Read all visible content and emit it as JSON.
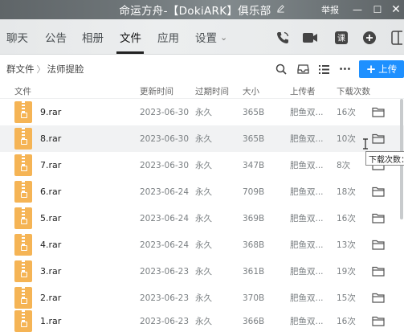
{
  "window": {
    "title": "命运方舟-【DokiARK】俱乐部",
    "edit_icon": "pencil-icon",
    "report_label": "举报",
    "controls": {
      "minimize": "—",
      "maximize": "☐",
      "close": "✕"
    }
  },
  "nav": {
    "tabs": [
      {
        "label": "聊天"
      },
      {
        "label": "公告"
      },
      {
        "label": "相册"
      },
      {
        "label": "文件"
      },
      {
        "label": "应用"
      },
      {
        "label": "设置"
      }
    ],
    "settings_chevron": "⌄",
    "active_tab": "文件"
  },
  "breadcrumb": {
    "root": "群文件",
    "separator": "〉",
    "current": "法师提脸"
  },
  "toolbar": {
    "more_label": "•••",
    "upload_label": "上传"
  },
  "table": {
    "headers": {
      "name": "文件",
      "updated": "更新时间",
      "expire": "过期时间",
      "size": "大小",
      "uploader": "上传者",
      "downloads": "下载次数"
    },
    "rows": [
      {
        "name": "9.rar",
        "updated": "2023-06-30",
        "expire": "永久",
        "size": "365B",
        "uploader": "肥鱼双...",
        "downloads": "16次"
      },
      {
        "name": "8.rar",
        "updated": "2023-06-30",
        "expire": "永久",
        "size": "365B",
        "uploader": "肥鱼双...",
        "downloads": "10次"
      },
      {
        "name": "7.rar",
        "updated": "2023-06-30",
        "expire": "永久",
        "size": "347B",
        "uploader": "肥鱼双...",
        "downloads": "8次"
      },
      {
        "name": "6.rar",
        "updated": "2023-06-24",
        "expire": "永久",
        "size": "709B",
        "uploader": "肥鱼双...",
        "downloads": "18次"
      },
      {
        "name": "5.rar",
        "updated": "2023-06-24",
        "expire": "永久",
        "size": "369B",
        "uploader": "肥鱼双...",
        "downloads": "16次"
      },
      {
        "name": "4.rar",
        "updated": "2023-06-24",
        "expire": "永久",
        "size": "368B",
        "uploader": "肥鱼双...",
        "downloads": "13次"
      },
      {
        "name": "3.rar",
        "updated": "2023-06-23",
        "expire": "永久",
        "size": "361B",
        "uploader": "肥鱼双...",
        "downloads": "19次"
      },
      {
        "name": "2.rar",
        "updated": "2023-06-23",
        "expire": "永久",
        "size": "370B",
        "uploader": "肥鱼双...",
        "downloads": "15次"
      },
      {
        "name": "1.rar",
        "updated": "2023-06-23",
        "expire": "永久",
        "size": "366B",
        "uploader": "肥鱼双...",
        "downloads": "16次"
      }
    ]
  },
  "tooltip": {
    "text": "下载次数："
  },
  "colors": {
    "accent": "#1e90ff",
    "zip_icon": "#f5b455",
    "hover_row": "#f1f2f3"
  }
}
